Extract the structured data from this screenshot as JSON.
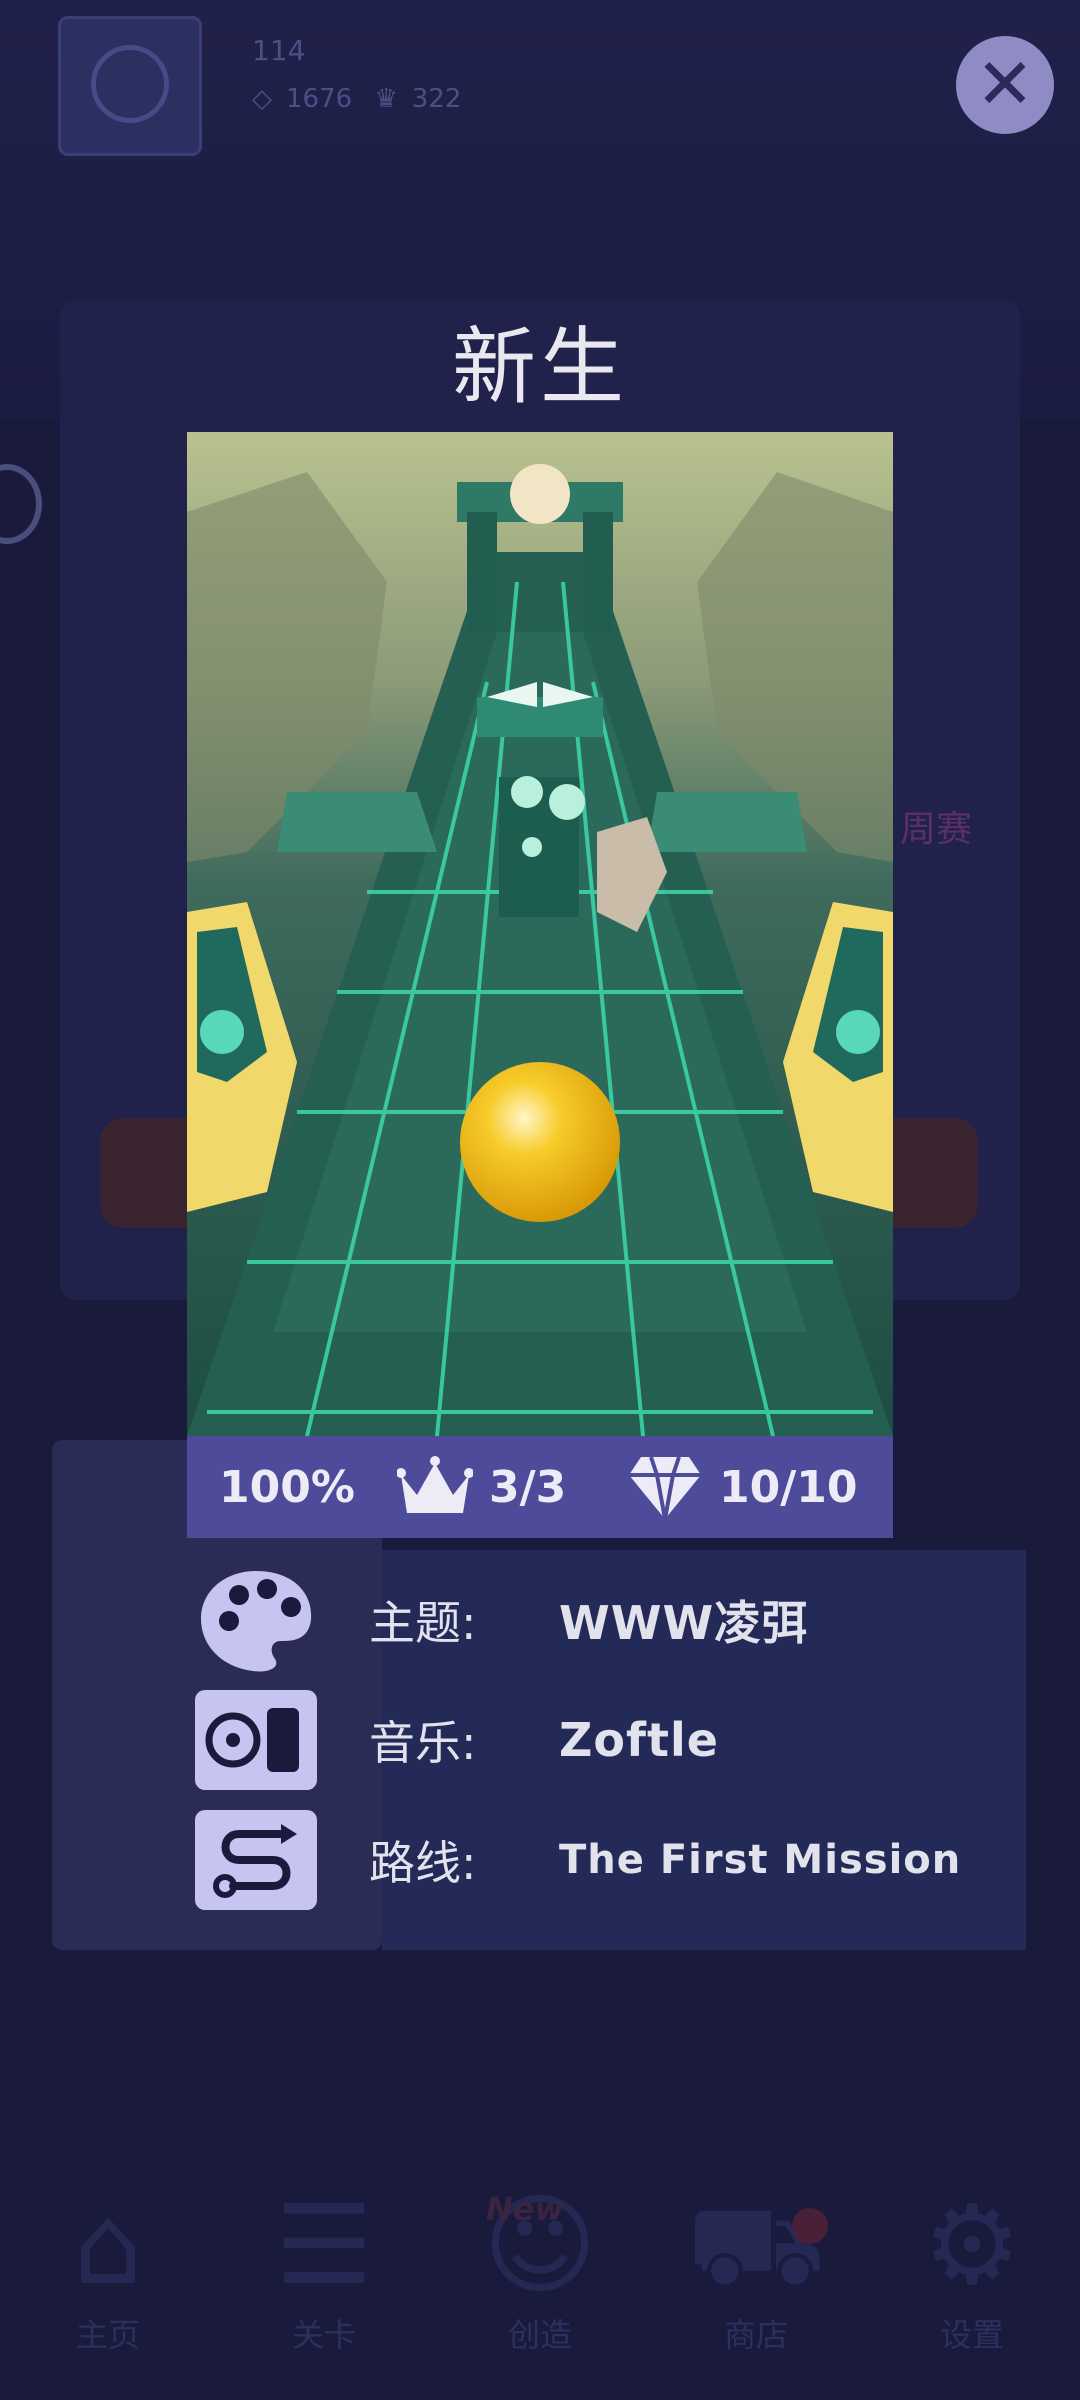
{
  "background": {
    "player_level": "114",
    "gems": "1676",
    "crowns": "322",
    "weekly_label": "周赛",
    "card_gems": "10/10",
    "card_percent": "100%",
    "nav": [
      {
        "label": "主页",
        "icon": "home-icon"
      },
      {
        "label": "关卡",
        "icon": "list-icon"
      },
      {
        "label": "创造",
        "icon": "bulb-icon"
      },
      {
        "label": "商店",
        "icon": "cart-icon"
      },
      {
        "label": "设置",
        "icon": "gear-icon"
      }
    ],
    "new_tag": "New"
  },
  "overlay": {
    "close_icon": "close-icon",
    "title": "新生",
    "stats": {
      "percent": "100%",
      "crowns": "3/3",
      "gems": "10/10"
    },
    "info": [
      {
        "icon": "palette-icon",
        "label": "主题:",
        "value": "WWW凌弭"
      },
      {
        "icon": "music-player-icon",
        "label": "音乐:",
        "value": "Zoftle"
      },
      {
        "icon": "route-icon",
        "label": "路线:",
        "value": "The First Mission"
      }
    ]
  },
  "colors": {
    "backdrop": "#1a1a3d",
    "stats_bar": "#4e4c9a",
    "icon_tile": "#c8c4f2",
    "ball": "#f4c01e",
    "track": "#1f5a4c"
  }
}
